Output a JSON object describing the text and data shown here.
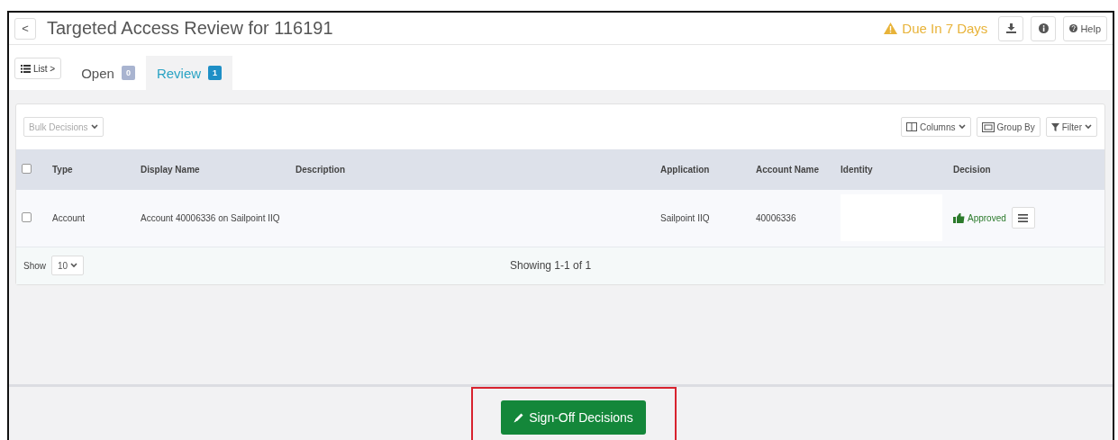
{
  "header": {
    "back_label": "<",
    "title": "Targeted Access Review for 116191",
    "due": "Due In 7 Days",
    "help": "Help"
  },
  "tabs": [
    {
      "kind": "list",
      "label": "List >"
    },
    {
      "kind": "tab",
      "label": "Open",
      "count": "0",
      "selected": false
    },
    {
      "kind": "tab",
      "label": "Review",
      "count": "1",
      "selected": true
    }
  ],
  "toolbar": {
    "bulk": "Bulk Decisions",
    "columns": "Columns",
    "group_by": "Group By",
    "filter": "Filter"
  },
  "table": {
    "columns": [
      "Type",
      "Display Name",
      "Description",
      "Application",
      "Account Name",
      "Identity",
      "Decision"
    ],
    "select_all_checked": false,
    "rows": [
      {
        "checked": false,
        "cells": [
          "Account",
          "Account 40006336 on Sailpoint IIQ",
          "",
          "Sailpoint IIQ",
          "40006336",
          "",
          ""
        ],
        "decision": "Approved"
      }
    ]
  },
  "footer": {
    "show_label": "Show",
    "page_size": "10",
    "summary": "Showing 1-1 of 1"
  },
  "signoff": {
    "label": "Sign-Off Decisions",
    "highlighted": true
  }
}
